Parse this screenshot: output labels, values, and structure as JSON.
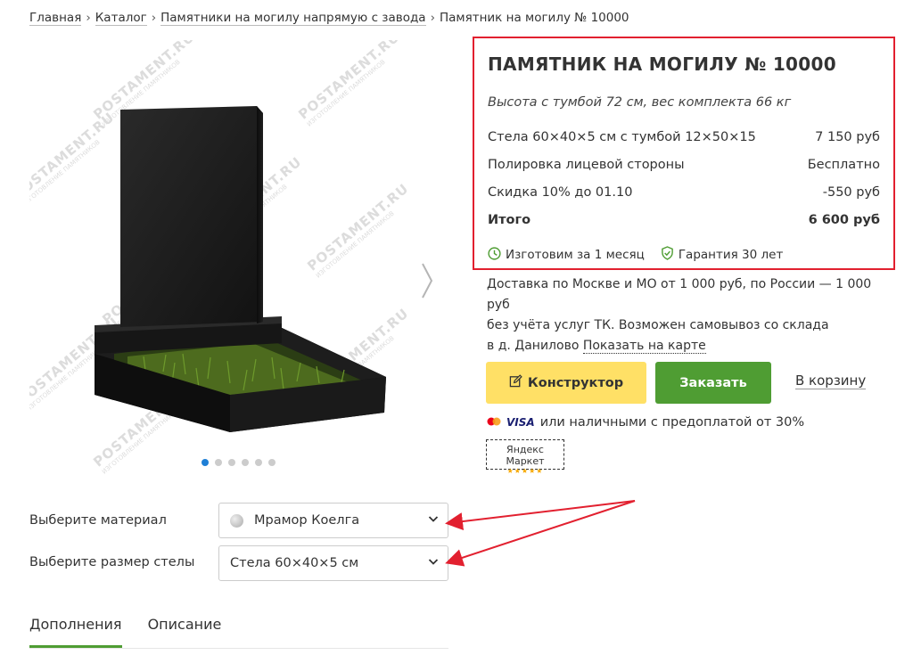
{
  "breadcrumb": {
    "items": [
      "Главная",
      "Каталог",
      "Памятники на могилу напрямую с завода"
    ],
    "current": "Памятник на могилу № 10000",
    "separator": "›"
  },
  "gallery": {
    "watermark": "POSTAMENT.RU",
    "watermark_sub": "ИЗГОТОВЛЕНИЕ ПАМЯТНИКОВ",
    "next_icon": "chevron-right-icon",
    "slide_count": 6,
    "active_slide": 1
  },
  "product": {
    "title": "ПАМЯТНИК НА МОГИЛУ № 10000",
    "subtitle": "Высота с тумбой 72 см, вес комплекта 66 кг",
    "prices": [
      {
        "label": "Стела 60×40×5 см с тумбой 12×50×15",
        "value": "7 150 руб"
      },
      {
        "label": "Полировка лицевой стороны",
        "value": "Бесплатно"
      },
      {
        "label": "Скидка 10% до 01.10",
        "value": "-550 руб"
      }
    ],
    "total": {
      "label": "Итого",
      "value": "6 600 руб"
    },
    "badges": [
      {
        "icon": "clock-icon",
        "text": "Изготовим за 1 месяц"
      },
      {
        "icon": "shield-check-icon",
        "text": "Гарантия 30 лет"
      }
    ],
    "highlight_color": "#e2202f"
  },
  "delivery": {
    "line1": "Доставка по Москве и МО от 1 000 руб, по России — 1 000 руб",
    "line2": "без учёта услуг ТК. Возможен самовывоз со склада",
    "line3": "в д. Данилово",
    "map_link": "Показать на карте"
  },
  "actions": {
    "constructor": "Конструктор",
    "order": "Заказать",
    "cart": "В корзину",
    "constructor_color": "#ffe066",
    "order_color": "#4f9d33"
  },
  "payment": {
    "visa": "VISA",
    "text": "или наличными с предоплатой от 30%"
  },
  "market_badge": {
    "text": "Яндекс Маркет",
    "stars": "★★★★★"
  },
  "options": {
    "material_label": "Выберите материал",
    "material_value": "Мрамор Коелга",
    "size_label": "Выберите размер стелы",
    "size_value": "Стела 60×40×5 см"
  },
  "tabs": [
    {
      "label": "Дополнения",
      "active": true
    },
    {
      "label": "Описание",
      "active": false
    }
  ]
}
